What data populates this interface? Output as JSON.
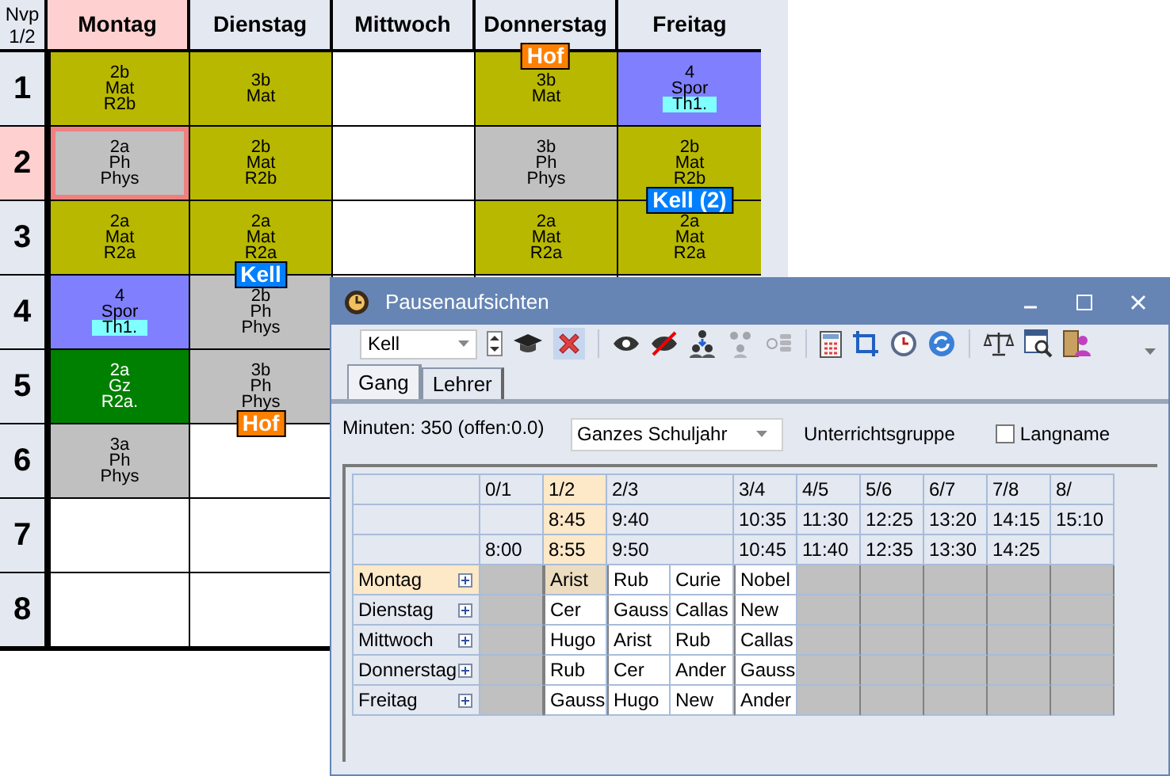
{
  "timetable": {
    "corner": [
      "Nvp",
      "1/2"
    ],
    "days": [
      {
        "name": "Montag",
        "selected": true
      },
      {
        "name": "Dienstag",
        "selected": false
      },
      {
        "name": "Mittwoch",
        "selected": false
      },
      {
        "name": "Donnerstag",
        "selected": false,
        "tag": {
          "text": "Hof",
          "color": "#ff8000"
        }
      },
      {
        "name": "Freitag",
        "selected": false
      }
    ],
    "rows": [
      {
        "period": "1",
        "selected": false,
        "cells": [
          {
            "lines": [
              "2b",
              "Mat",
              "R2b"
            ],
            "color": "#b8b800"
          },
          {
            "lines": [
              "3b",
              "Mat"
            ],
            "color": "#b8b800"
          },
          {},
          {
            "lines": [
              "3b",
              "Mat"
            ],
            "color": "#b8b800"
          },
          {
            "lines": [
              "4",
              "Spor",
              "Th1."
            ],
            "color": "#8080ff",
            "room_highlight": true
          }
        ]
      },
      {
        "period": "2",
        "selected": true,
        "cells": [
          {
            "lines": [
              "2a",
              "Ph",
              "Phys"
            ],
            "color": "#c0c0c0",
            "selected": true
          },
          {
            "lines": [
              "2b",
              "Mat",
              "R2b"
            ],
            "color": "#b8b800"
          },
          {},
          {
            "lines": [
              "3b",
              "Ph",
              "Phys"
            ],
            "color": "#c0c0c0"
          },
          {
            "lines": [
              "2b",
              "Mat",
              "R2b"
            ],
            "color": "#b8b800",
            "tag": {
              "text": "Kell (2)",
              "color": "#0080ff"
            }
          }
        ]
      },
      {
        "period": "3",
        "selected": false,
        "cells": [
          {
            "lines": [
              "2a",
              "Mat",
              "R2a"
            ],
            "color": "#b8b800"
          },
          {
            "lines": [
              "2a",
              "Mat",
              "R2a"
            ],
            "color": "#b8b800",
            "tag": {
              "text": "Kell",
              "color": "#0080ff"
            }
          },
          {},
          {
            "lines": [
              "2a",
              "Mat",
              "R2a"
            ],
            "color": "#b8b800"
          },
          {
            "lines": [
              "2a",
              "Mat",
              "R2a"
            ],
            "color": "#b8b800"
          }
        ]
      },
      {
        "period": "4",
        "selected": false,
        "cells": [
          {
            "lines": [
              "4",
              "Spor",
              "Th1."
            ],
            "color": "#8080ff",
            "room_highlight": true
          },
          {
            "lines": [
              "2b",
              "Ph",
              "Phys"
            ],
            "color": "#c0c0c0"
          }
        ]
      },
      {
        "period": "5",
        "selected": false,
        "cells": [
          {
            "lines": [
              "2a",
              "Gz",
              "R2a."
            ],
            "color": "#008000",
            "light_text": true
          },
          {
            "lines": [
              "3b",
              "Ph",
              "Phys"
            ],
            "color": "#c0c0c0",
            "tag": {
              "text": "Hof",
              "color": "#ff8000"
            }
          }
        ]
      },
      {
        "period": "6",
        "selected": false,
        "cells": [
          {
            "lines": [
              "3a",
              "Ph",
              "Phys"
            ],
            "color": "#c0c0c0"
          },
          {}
        ]
      },
      {
        "period": "7",
        "selected": false,
        "cells": [
          {},
          {}
        ]
      },
      {
        "period": "8",
        "selected": false,
        "cells": [
          {},
          {}
        ]
      }
    ]
  },
  "dialog": {
    "title": "Pausenaufsichten",
    "teacher_select": "Kell",
    "tabs": [
      {
        "label": "Gang",
        "selected": true
      },
      {
        "label": "Lehrer",
        "selected": false
      }
    ],
    "minutes": "Minuten: 350 (offen:0.0)",
    "period_select": "Ganzes Schuljahr",
    "group_label": "Unterrichtsgruppe",
    "long_name": {
      "label": "Langname",
      "checked": false
    },
    "breaks": [
      {
        "label": "0/1",
        "end": "8:00",
        "staffed": false,
        "selected": false
      },
      {
        "label": "1/2",
        "start": "8:45",
        "end": "8:55",
        "staffed": true,
        "selected": true
      },
      {
        "label": "2/3",
        "start": "9:40",
        "end": "9:50",
        "staffed": true,
        "selected": false,
        "wide": true
      },
      {
        "label": "3/4",
        "start": "10:35",
        "end": "10:45",
        "staffed": true,
        "selected": false
      },
      {
        "label": "4/5",
        "start": "11:30",
        "end": "11:40",
        "staffed": false,
        "selected": false
      },
      {
        "label": "5/6",
        "start": "12:25",
        "end": "12:35",
        "staffed": false,
        "selected": false
      },
      {
        "label": "6/7",
        "start": "13:20",
        "end": "13:30",
        "staffed": false,
        "selected": false
      },
      {
        "label": "7/8",
        "start": "14:15",
        "end": "14:25",
        "staffed": false,
        "selected": false
      },
      {
        "label": "8/",
        "start": "15:10",
        "staffed": false,
        "selected": false
      }
    ],
    "days": [
      {
        "name": "Montag",
        "selected": true,
        "expanded": false,
        "duties": [
          "Arist",
          "Rub",
          "Curie",
          "Nobel"
        ]
      },
      {
        "name": "Dienstag",
        "selected": false,
        "expanded": false,
        "duties": [
          "Cer",
          "Gauss",
          "Callas",
          "New"
        ]
      },
      {
        "name": "Mittwoch",
        "selected": false,
        "expanded": false,
        "duties": [
          "Hugo",
          "Arist",
          "Rub",
          "Callas"
        ]
      },
      {
        "name": "Donnerstag",
        "selected": false,
        "expanded": false,
        "duties": [
          "Rub",
          "Cer",
          "Ander",
          "Gauss"
        ]
      },
      {
        "name": "Freitag",
        "selected": false,
        "expanded": false,
        "duties": [
          "Gauss",
          "Hugo",
          "New",
          "Ander"
        ]
      }
    ]
  }
}
